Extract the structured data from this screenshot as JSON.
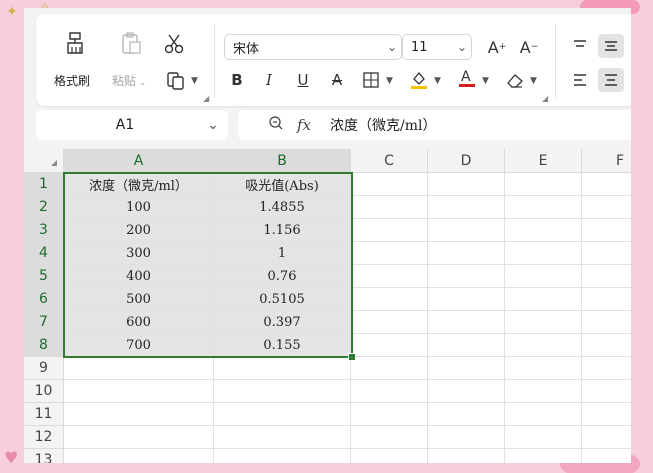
{
  "toolbar": {
    "format_painter_label": "格式刷",
    "paste_label": "粘贴",
    "font_name": "宋体",
    "font_size": "11"
  },
  "formula_bar": {
    "name_box": "A1",
    "fx_label": "fx",
    "formula": "浓度（微克/ml）"
  },
  "sheet": {
    "columns": [
      "A",
      "B",
      "C",
      "D",
      "E",
      "F"
    ],
    "rows": [
      "1",
      "2",
      "3",
      "4",
      "5",
      "6",
      "7",
      "8",
      "9",
      "10",
      "11",
      "12",
      "13"
    ],
    "data": [
      [
        "浓度（微克/ml）",
        "吸光值(Abs)"
      ],
      [
        "100",
        "1.4855"
      ],
      [
        "200",
        "1.156"
      ],
      [
        "300",
        "1"
      ],
      [
        "400",
        "0.76"
      ],
      [
        "500",
        "0.5105"
      ],
      [
        "600",
        "0.397"
      ],
      [
        "700",
        "0.155"
      ]
    ]
  },
  "colors": {
    "selection_border": "#2e7d32",
    "active_header_text": "#1f6a2c",
    "page_background": "#f7cfdc"
  }
}
